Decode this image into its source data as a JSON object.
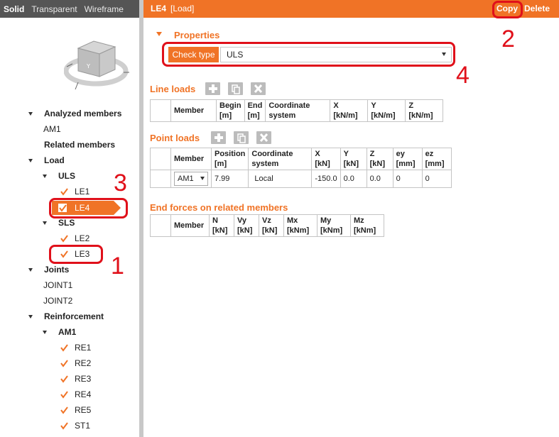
{
  "view_modes": [
    "Solid",
    "Transparent",
    "Wireframe"
  ],
  "tree": {
    "analyzed_members": "Analyzed members",
    "am1": "AM1",
    "related_members": "Related members",
    "load": "Load",
    "uls": "ULS",
    "le1": "LE1",
    "le4": "LE4",
    "sls": "SLS",
    "le2": "LE2",
    "le3": "LE3",
    "joints": "Joints",
    "joint1": "JOINT1",
    "joint2": "JOINT2",
    "reinforcement": "Reinforcement",
    "reinf_am1": "AM1",
    "re1": "RE1",
    "re2": "RE2",
    "re3": "RE3",
    "re4": "RE4",
    "re5": "RE5",
    "st1": "ST1"
  },
  "header": {
    "title": "LE4",
    "subtitle": "[Load]",
    "copy": "Copy",
    "delete": "Delete"
  },
  "properties": {
    "title": "Properties",
    "check_type_label": "Check type",
    "check_type_value": "ULS"
  },
  "line_loads": {
    "title": "Line loads",
    "columns": [
      [
        "Member",
        ""
      ],
      [
        "Begin",
        "[m]"
      ],
      [
        "End",
        "[m]"
      ],
      [
        "Coordinate",
        "system"
      ],
      [
        "X",
        "[kN/m]"
      ],
      [
        "Y",
        "[kN/m]"
      ],
      [
        "Z",
        "[kN/m]"
      ]
    ]
  },
  "point_loads": {
    "title": "Point loads",
    "columns": [
      [
        "Member",
        ""
      ],
      [
        "Position",
        "[m]"
      ],
      [
        "Coordinate",
        "system"
      ],
      [
        "X",
        "[kN]"
      ],
      [
        "Y",
        "[kN]"
      ],
      [
        "Z",
        "[kN]"
      ],
      [
        "ey",
        "[mm]"
      ],
      [
        "ez",
        "[mm]"
      ]
    ],
    "row": {
      "member": "AM1",
      "position": "7.99",
      "system": "Local",
      "x": "-150.0",
      "y": "0.0",
      "z": "0.0",
      "ey": "0",
      "ez": "0"
    }
  },
  "end_forces": {
    "title": "End forces on related members",
    "columns": [
      [
        "Member",
        ""
      ],
      [
        "N",
        "[kN]"
      ],
      [
        "Vy",
        "[kN]"
      ],
      [
        "Vz",
        "[kN]"
      ],
      [
        "Mx",
        "[kNm]"
      ],
      [
        "My",
        "[kNm]"
      ],
      [
        "Mz",
        "[kNm]"
      ]
    ]
  },
  "annotations": {
    "n1": "1",
    "n2": "2",
    "n3": "3",
    "n4": "4"
  },
  "colors": {
    "accent": "#f07326",
    "annotation": "#e0101a"
  }
}
